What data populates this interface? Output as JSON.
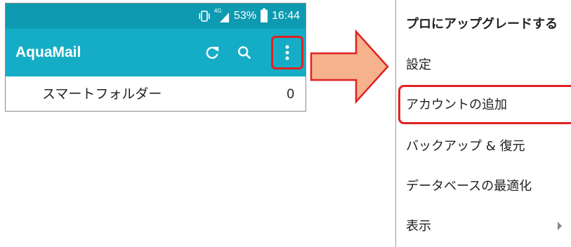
{
  "phone": {
    "status": {
      "network": "4G",
      "battery": "53%",
      "time": "16:44"
    },
    "appbar": {
      "title": "AquaMail"
    },
    "smart_folder": {
      "label": "スマートフォルダー",
      "count": "0"
    }
  },
  "menu": {
    "items": [
      {
        "label": "プロにアップグレードする"
      },
      {
        "label": "設定"
      },
      {
        "label": "アカウントの追加"
      },
      {
        "label": "バックアップ & 復元"
      },
      {
        "label": "データベースの最適化"
      },
      {
        "label": "表示"
      }
    ]
  },
  "colors": {
    "statusbar": "#0e9bb2",
    "appbar": "#15adc6",
    "highlight": "#e02121",
    "arrow_fill": "#f5b28c"
  },
  "icons": [
    "vibrate-icon",
    "signal-icon",
    "battery-icon",
    "refresh-icon",
    "search-icon",
    "overflow-menu-icon",
    "arrow-right-icon",
    "submenu-arrow-icon"
  ]
}
